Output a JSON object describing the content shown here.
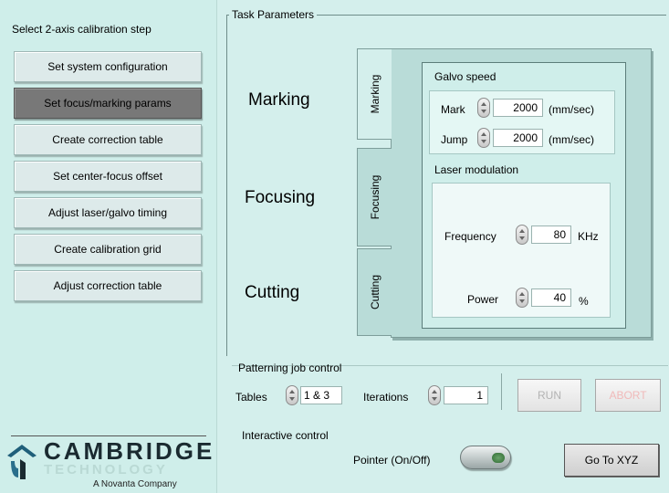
{
  "left": {
    "title": "Select 2-axis calibration step",
    "steps": [
      {
        "label": "Set system configuration",
        "active": false
      },
      {
        "label": "Set focus/marking params",
        "active": true
      },
      {
        "label": "Create correction table",
        "active": false
      },
      {
        "label": "Set center-focus offset",
        "active": false
      },
      {
        "label": "Adjust laser/galvo timing",
        "active": false
      },
      {
        "label": "Create calibration grid",
        "active": false
      },
      {
        "label": "Adjust correction table",
        "active": false
      }
    ],
    "logo": {
      "name": "CAMBRIDGE",
      "sub": "TECHNOLOGY",
      "tagline": "A Novanta Company"
    }
  },
  "task": {
    "title": "Task Parameters",
    "sections": [
      "Marking",
      "Focusing",
      "Cutting"
    ],
    "tabs": [
      "Marking",
      "Focusing",
      "Cutting"
    ],
    "active_tab": "Marking"
  },
  "galvo": {
    "title": "Galvo speed",
    "mark_label": "Mark",
    "mark_value": "2000",
    "jump_label": "Jump",
    "jump_value": "2000",
    "unit": "(mm/sec)"
  },
  "laser": {
    "title": "Laser modulation",
    "frequency_label": "Frequency",
    "frequency_value": "80",
    "frequency_unit": "KHz",
    "power_label": "Power",
    "power_value": "40",
    "power_unit": "%"
  },
  "patterning": {
    "title": "Patterning job control",
    "tables_label": "Tables",
    "tables_value": "1 & 3",
    "iterations_label": "Iterations",
    "iterations_value": "1",
    "run_label": "RUN",
    "abort_label": "ABORT"
  },
  "interactive": {
    "title": "Interactive control",
    "pointer_label": "Pointer (On/Off)",
    "goto_label": "Go To XYZ"
  },
  "colors": {
    "background": "#d4efec",
    "active_step": "#787878",
    "abort_disabled": "#f0b9b9"
  }
}
